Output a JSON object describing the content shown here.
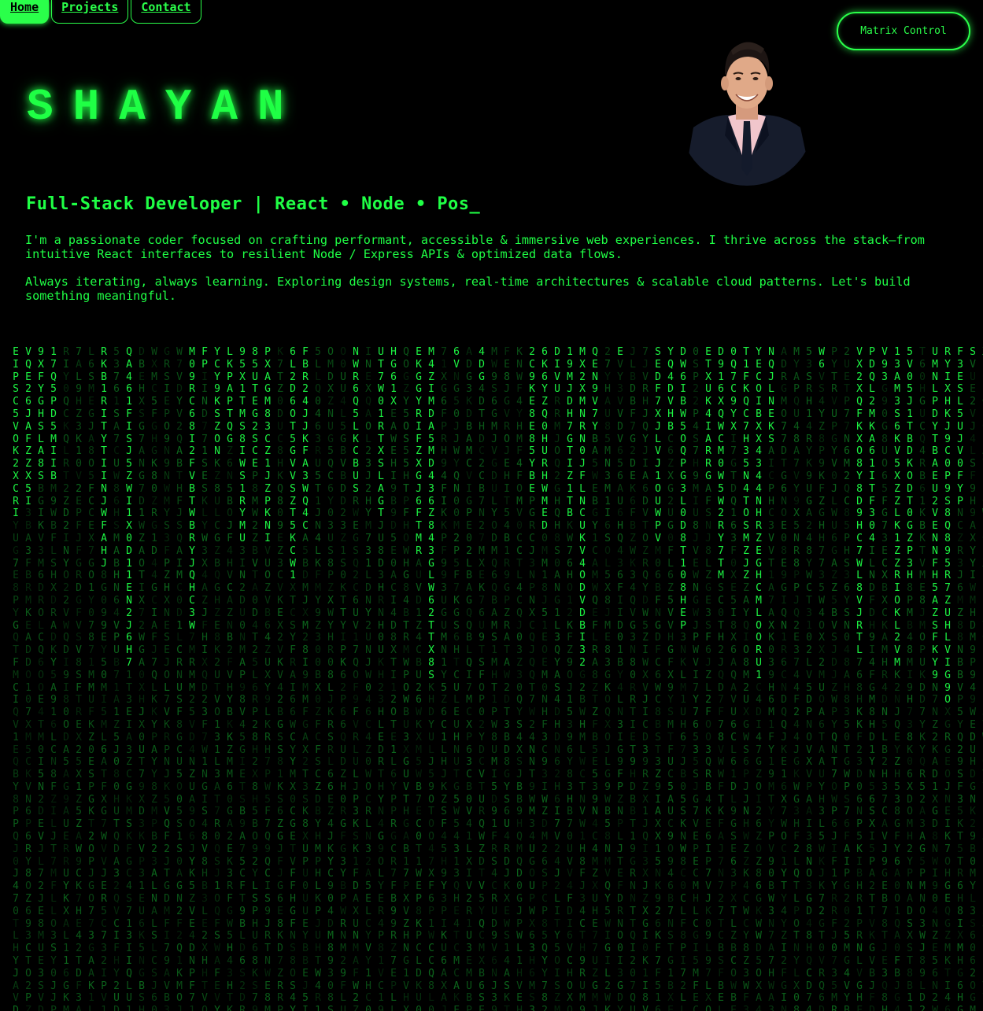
{
  "nav": {
    "items": [
      {
        "label": "Home",
        "active": true
      },
      {
        "label": "Projects",
        "active": false
      },
      {
        "label": "Contact",
        "active": false
      }
    ]
  },
  "controls": {
    "matrix_control_label": "Matrix Control"
  },
  "hero": {
    "name": "SHAYAN",
    "headline": "Full-Stack Developer | React • Node • Pos_",
    "bio": [
      "I'm a passionate coder focused on crafting performant, accessible & immersive web experiences. I thrive across the stack—from intuitive React interfaces to resilient Node / Express APIs & optimized data flows.",
      "Always iterating, always learning. Exploring design systems, real-time architectures & scalable cloud patterns. Let's build something meaningful."
    ]
  },
  "theme": {
    "accent": "#1fff45",
    "background": "#000000"
  }
}
